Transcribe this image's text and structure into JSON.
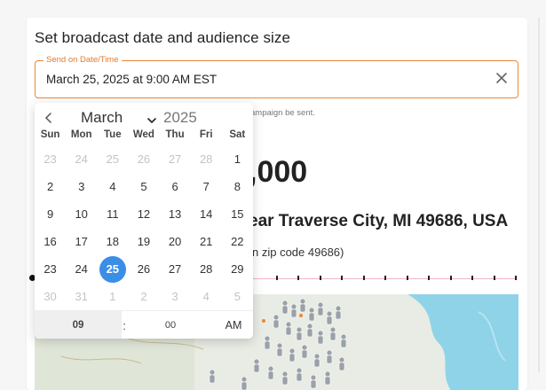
{
  "card": {
    "title": "Set broadcast date and audience size"
  },
  "send_field": {
    "label": "Send on Date/Time",
    "value": "March 25, 2025 at 9:00 AM EST",
    "clear_icon": "close-icon"
  },
  "helper_text": "ampaign be sent.",
  "audience_count": ",000",
  "location_text": "ear Traverse City, MI 49686, USA",
  "location_sub": "n zip code 49686)",
  "colors": {
    "accent": "#e8883a",
    "selected_day": "#3a8ee6",
    "track": "#f2b6c2",
    "map_water": "#8fd3e8"
  },
  "calendar": {
    "prev_icon": "chevron-left-icon",
    "month": "March",
    "month_options": [
      "March"
    ],
    "year": "2025",
    "weekdays": [
      "Sun",
      "Mon",
      "Tue",
      "Wed",
      "Thu",
      "Fri",
      "Sat"
    ],
    "days": [
      {
        "label": "23",
        "muted": true
      },
      {
        "label": "24",
        "muted": true
      },
      {
        "label": "25",
        "muted": true
      },
      {
        "label": "26",
        "muted": true
      },
      {
        "label": "27",
        "muted": true
      },
      {
        "label": "28",
        "muted": true
      },
      {
        "label": "1",
        "muted": false
      },
      {
        "label": "2",
        "muted": false
      },
      {
        "label": "3",
        "muted": false
      },
      {
        "label": "4",
        "muted": false
      },
      {
        "label": "5",
        "muted": false
      },
      {
        "label": "6",
        "muted": false
      },
      {
        "label": "7",
        "muted": false
      },
      {
        "label": "8",
        "muted": false
      },
      {
        "label": "9",
        "muted": false
      },
      {
        "label": "10",
        "muted": false
      },
      {
        "label": "11",
        "muted": false
      },
      {
        "label": "12",
        "muted": false
      },
      {
        "label": "13",
        "muted": false
      },
      {
        "label": "14",
        "muted": false
      },
      {
        "label": "15",
        "muted": false
      },
      {
        "label": "16",
        "muted": false
      },
      {
        "label": "17",
        "muted": false
      },
      {
        "label": "18",
        "muted": false
      },
      {
        "label": "19",
        "muted": false
      },
      {
        "label": "20",
        "muted": false
      },
      {
        "label": "21",
        "muted": false
      },
      {
        "label": "22",
        "muted": false
      },
      {
        "label": "23",
        "muted": false
      },
      {
        "label": "24",
        "muted": false
      },
      {
        "label": "25",
        "muted": false,
        "selected": true
      },
      {
        "label": "26",
        "muted": false
      },
      {
        "label": "27",
        "muted": false
      },
      {
        "label": "28",
        "muted": false
      },
      {
        "label": "29",
        "muted": false
      },
      {
        "label": "30",
        "muted": true
      },
      {
        "label": "31",
        "muted": true
      },
      {
        "label": "1",
        "muted": true
      },
      {
        "label": "2",
        "muted": true
      },
      {
        "label": "3",
        "muted": true
      },
      {
        "label": "4",
        "muted": true
      },
      {
        "label": "5",
        "muted": true
      }
    ],
    "time": {
      "hour": "09",
      "separator": ":",
      "minute": "00",
      "ampm": "AM"
    }
  }
}
